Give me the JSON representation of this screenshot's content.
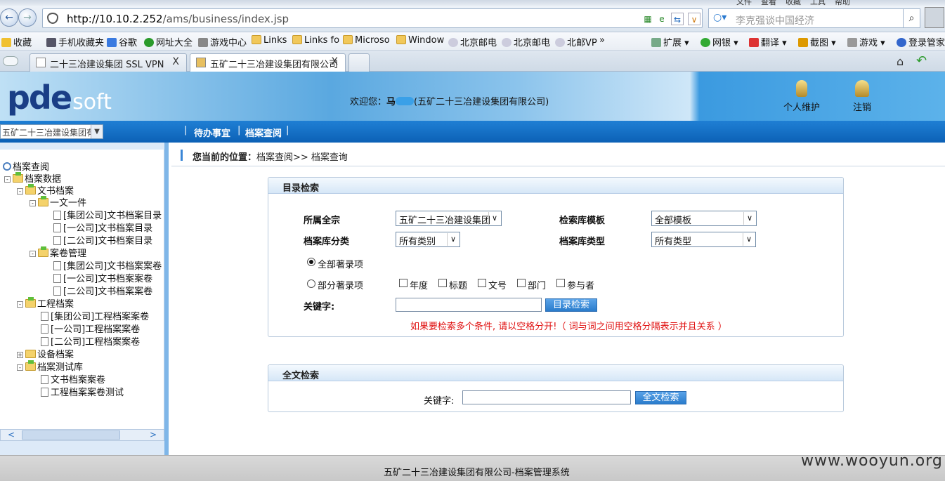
{
  "browser": {
    "top_menu": [
      "文件",
      "查看",
      "收藏",
      "工具",
      "帮助"
    ],
    "url_host": "http://10.10.2.252",
    "url_path": "/ams/business/index.jsp",
    "search_text": "李克强谈中国经济",
    "favorites": [
      "收藏",
      "手机收藏夹",
      "谷歌",
      "网址大全",
      "游戏中心",
      "Links",
      "Links fo",
      "Microso",
      "Window",
      "北京邮电",
      "北京邮电",
      "北邮VP",
      "»"
    ],
    "fav_right": [
      "扩展",
      "网银",
      "翻译",
      "截图",
      "游戏",
      "登录管家"
    ],
    "tabs": [
      {
        "label": "二十三冶建设集团 SSL VPN",
        "close": "X"
      },
      {
        "label": "五矿二十三冶建设集团有限公司",
        "close": "X"
      }
    ]
  },
  "header": {
    "logo_main": "pde",
    "logo_sub": "soft",
    "welcome_prefix": "欢迎您：",
    "welcome_user": "马",
    "welcome_org": "(五矿二十三冶建设集团有限公司)",
    "actions": [
      "个人维护",
      "注销"
    ]
  },
  "nav": {
    "unit_select": "五矿二十三冶建设集团有",
    "sep": "|",
    "links": [
      "待办事宜",
      "档案查阅"
    ]
  },
  "tree": [
    {
      "label": "档案查阅"
    },
    {
      "label": "档案数据"
    },
    {
      "label": "文书档案"
    },
    {
      "label": "一文一件"
    },
    {
      "label": "[集团公司]文书档案目录"
    },
    {
      "label": "[一公司]文书档案目录"
    },
    {
      "label": "[二公司]文书档案目录"
    },
    {
      "label": "案卷管理"
    },
    {
      "label": "[集团公司]文书档案案卷"
    },
    {
      "label": "[一公司]文书档案案卷"
    },
    {
      "label": "[二公司]文书档案案卷"
    },
    {
      "label": "工程档案"
    },
    {
      "label": "[集团公司]工程档案案卷"
    },
    {
      "label": "[一公司]工程档案案卷"
    },
    {
      "label": "[二公司]工程档案案卷"
    },
    {
      "label": "设备档案"
    },
    {
      "label": "档案测试库"
    },
    {
      "label": "文书档案案卷"
    },
    {
      "label": "工程档案案卷测试"
    }
  ],
  "breadcrumb": {
    "prefix": "您当前的位置：",
    "path": "档案查阅>> 档案查询"
  },
  "catalog_search": {
    "title": "目录检索",
    "fonds_label": "所属全宗",
    "fonds_value": "五矿二十三冶建设集团",
    "template_label": "检索库模板",
    "template_value": "全部模板",
    "category_label": "档案库分类",
    "category_value": "所有类别",
    "type_label": "档案库类型",
    "type_value": "所有类型",
    "radio_all": "全部著录项",
    "radio_part": "部分著录项",
    "fields": [
      "年度",
      "标题",
      "文号",
      "部门",
      "参与者"
    ],
    "keyword_label": "关键字:",
    "button": "目录检索",
    "hint": "如果要检索多个条件, 请以空格分开!（ 词与词之间用空格分隔表示并且关系 ）"
  },
  "fulltext_search": {
    "title": "全文检索",
    "keyword_label": "关键字:",
    "button": "全文检索"
  },
  "footer": "五矿二十三冶建设集团有限公司-档案管理系统",
  "watermark": "www.wooyun.org"
}
